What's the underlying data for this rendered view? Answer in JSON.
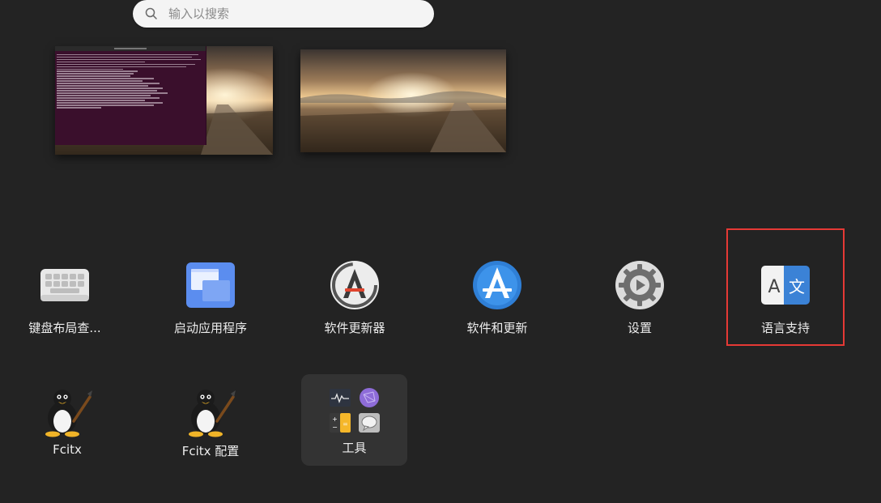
{
  "search": {
    "placeholder": "输入以搜索"
  },
  "apps": [
    {
      "label": "键盘布局查...",
      "icon": "keyboard-icon"
    },
    {
      "label": "启动应用程序",
      "icon": "startup-apps-icon"
    },
    {
      "label": "软件更新器",
      "icon": "software-updater-icon"
    },
    {
      "label": "软件和更新",
      "icon": "software-and-updates-icon"
    },
    {
      "label": "设置",
      "icon": "settings-gear-icon"
    },
    {
      "label": "语言支持",
      "icon": "language-support-icon",
      "selected": true
    }
  ],
  "apps_row2": [
    {
      "label": "Fcitx",
      "icon": "fcitx-penguin-icon"
    },
    {
      "label": "Fcitx 配置",
      "icon": "fcitx-config-penguin-icon"
    }
  ],
  "folder": {
    "label": "工具",
    "icons": [
      "system-monitor-icon",
      "network-icon",
      "calculator-icon",
      "chat-icon"
    ]
  },
  "colors": {
    "background": "#232323",
    "selection_outline": "#e53935",
    "terminal_bg": "#3a0f2c"
  }
}
